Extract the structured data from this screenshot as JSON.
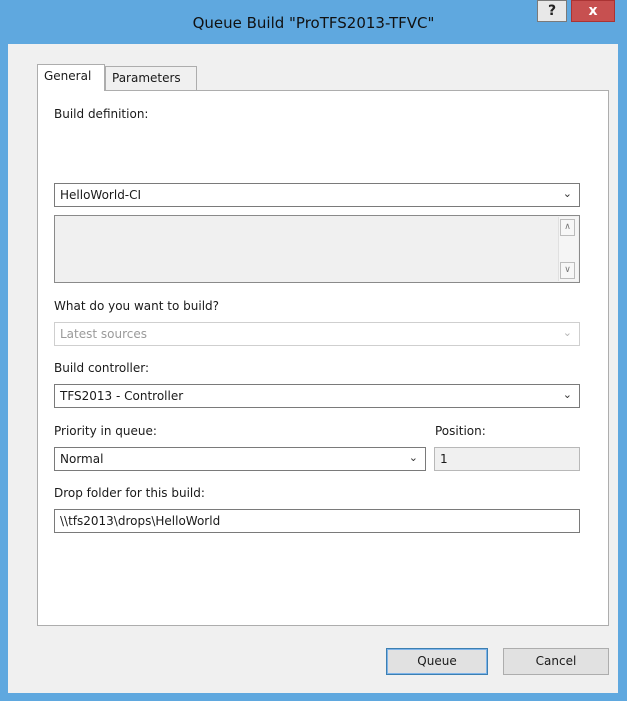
{
  "window": {
    "title": "Queue Build \"ProTFS2013-TFVC\"",
    "help_label": "?",
    "close_label": "x"
  },
  "tabs": [
    {
      "label": "General",
      "selected": true
    },
    {
      "label": "Parameters",
      "selected": false
    }
  ],
  "general": {
    "build_definition_label": "Build definition:",
    "build_definition_value": "HelloWorld-CI",
    "description_value": "",
    "what_to_build_label": "What do you want to build?",
    "what_to_build_value": "Latest sources",
    "build_controller_label": "Build controller:",
    "build_controller_value": "TFS2013 - Controller",
    "priority_label": "Priority in queue:",
    "priority_value": "Normal",
    "position_label": "Position:",
    "position_value": "1",
    "drop_folder_label": "Drop folder for this build:",
    "drop_folder_value": "\\\\tfs2013\\drops\\HelloWorld"
  },
  "buttons": {
    "queue_label": "Queue",
    "cancel_label": "Cancel"
  },
  "icons": {
    "dropdown": "chevron-down-icon",
    "scroll_up": "scroll-up-icon",
    "scroll_down": "scroll-down-icon"
  },
  "colors": {
    "title_bar": "#5fa8df",
    "close_button": "#c75050",
    "dialog_background": "#f0f0f0",
    "default_button_border": "#3c7fb1"
  }
}
